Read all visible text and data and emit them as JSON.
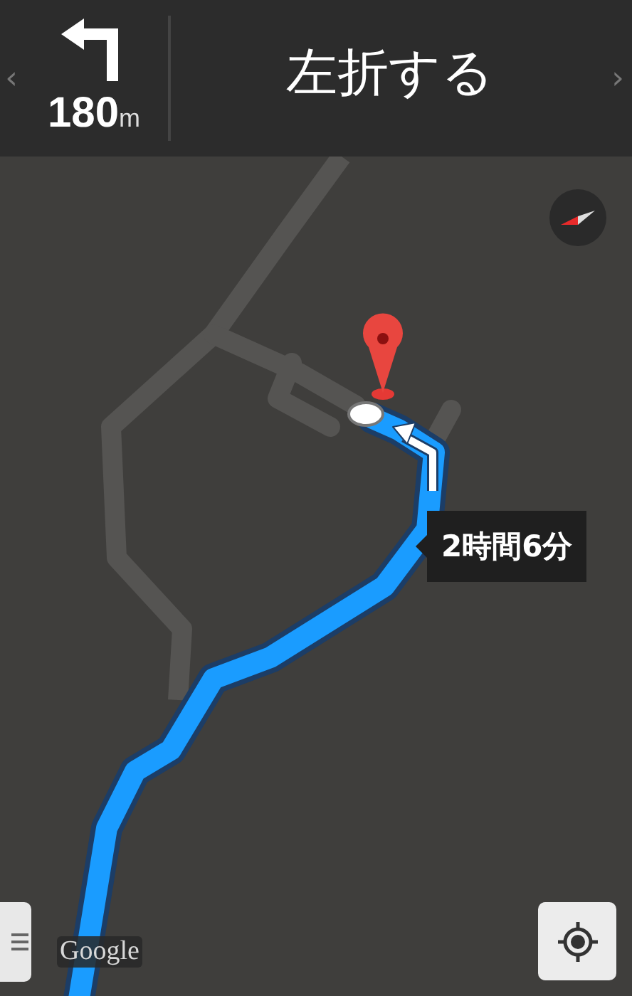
{
  "instruction": {
    "kind": "left",
    "distance": "180",
    "unit": "m",
    "text": "左折する",
    "prev": "‹",
    "next": "›"
  },
  "map": {
    "duration_callout": "2時間6分",
    "attribution": "Google"
  }
}
